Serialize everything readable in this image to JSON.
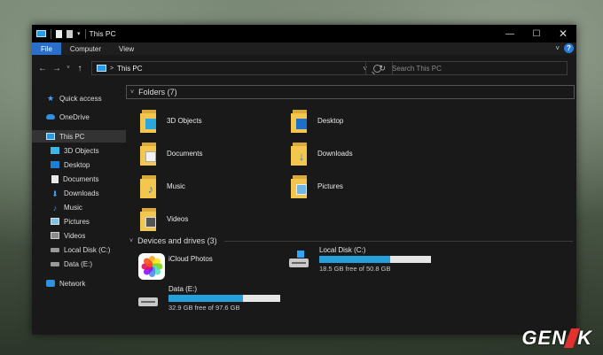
{
  "window": {
    "title": "This PC"
  },
  "window_controls": {
    "minimize": "—",
    "maximize": "☐",
    "close": "✕"
  },
  "ribbon": {
    "tabs": [
      "File",
      "Computer",
      "View"
    ],
    "help": "?"
  },
  "nav": {
    "back": "←",
    "forward": "→",
    "recent": "˅",
    "up": "↑"
  },
  "address": {
    "separator": ">",
    "path": "This PC",
    "dropdown": "˅",
    "refresh": "↻"
  },
  "search": {
    "placeholder": "Search This PC"
  },
  "sidebar": {
    "items": [
      "Quick access",
      "OneDrive",
      "This PC",
      "3D Objects",
      "Desktop",
      "Documents",
      "Downloads",
      "Music",
      "Pictures",
      "Videos",
      "Local Disk (C:)",
      "Data (E:)",
      "Network"
    ],
    "selected": "This PC"
  },
  "folders_group": {
    "label": "Folders (7)",
    "chevron": "˅"
  },
  "folders": [
    "3D Objects",
    "Desktop",
    "Documents",
    "Downloads",
    "Music",
    "Pictures",
    "Videos"
  ],
  "drives_group": {
    "label": "Devices and drives (3)",
    "chevron": "˅"
  },
  "drives": [
    {
      "name": "iCloud Photos"
    },
    {
      "name": "Local Disk (C:)",
      "free": "18.5 GB free of 50.8 GB",
      "used_fraction": 0.636
    },
    {
      "name": "Data (E:)",
      "free": "32.9 GB free of 97.6 GB",
      "used_fraction": 0.663
    }
  ],
  "watermark": {
    "text_left": "GEN",
    "text_right": "K"
  },
  "colors": {
    "accent": "#2a6fc9",
    "bar_fill": "#26a0da",
    "folder": "#f3c74d"
  }
}
